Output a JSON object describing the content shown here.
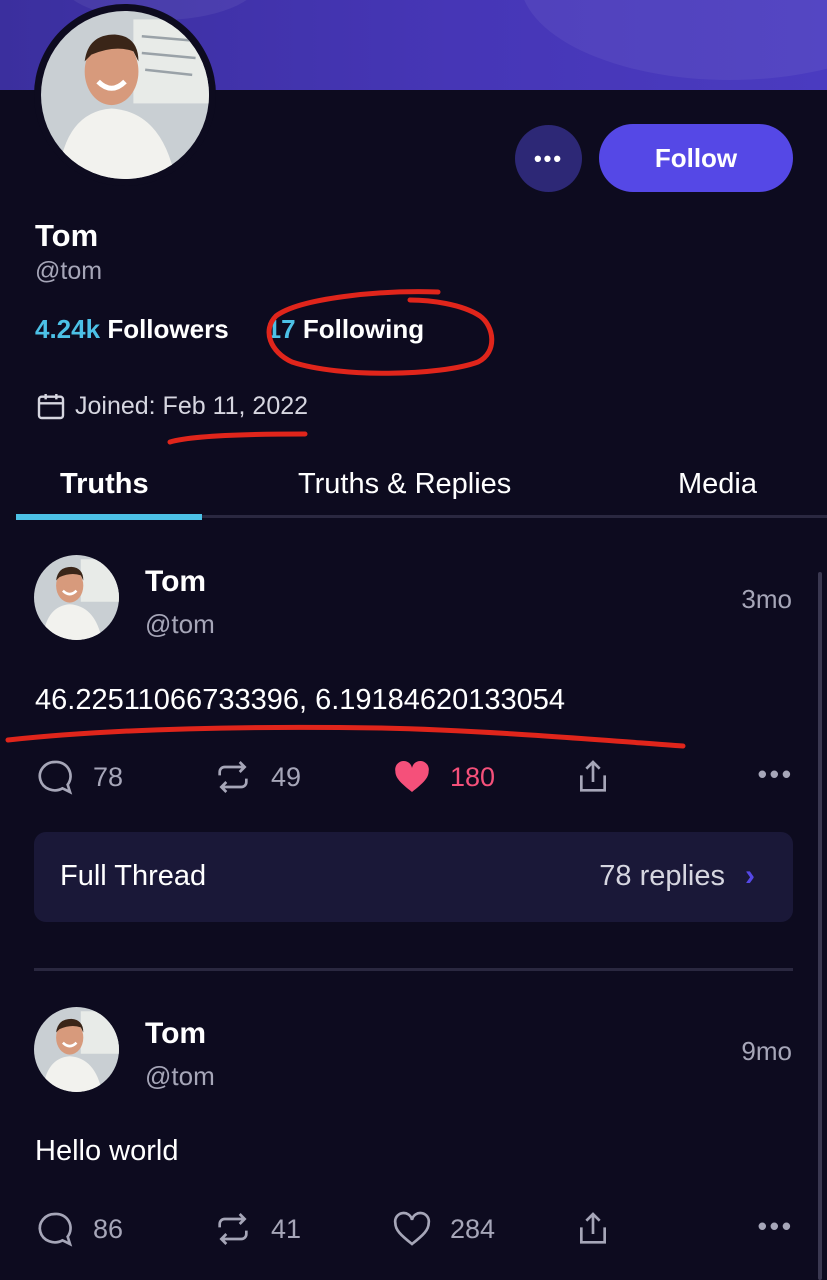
{
  "profile": {
    "name": "Tom",
    "handle": "@tom",
    "follow_label": "Follow",
    "more_label": "•••",
    "followers_count": "4.24k",
    "followers_label": "Followers",
    "following_count": "17",
    "following_label": "Following",
    "joined_text": "Joined: Feb 11, 2022"
  },
  "tabs": [
    {
      "label": "Truths",
      "active": true
    },
    {
      "label": "Truths & Replies",
      "active": false
    },
    {
      "label": "Media",
      "active": false
    }
  ],
  "posts": [
    {
      "name": "Tom",
      "handle": "@tom",
      "time": "3mo",
      "text": "46.22511066733396, 6.19184620133054",
      "replies": "78",
      "reposts": "49",
      "likes": "180",
      "liked": true
    },
    {
      "name": "Tom",
      "handle": "@tom",
      "time": "9mo",
      "text": "Hello world",
      "replies": "86",
      "reposts": "41",
      "likes": "284",
      "liked": false
    }
  ],
  "thread": {
    "label": "Full Thread",
    "replies": "78 replies",
    "chevron": "›"
  },
  "colors": {
    "background": "#0d0b1f",
    "accent": "#5548e6",
    "link": "#4cc1e6",
    "like": "#f5507a",
    "annotation": "#e0251b"
  },
  "icons": [
    "calendar-icon",
    "reply-icon",
    "repost-icon",
    "heart-icon",
    "share-icon",
    "more-icon",
    "chevron-right-icon"
  ]
}
